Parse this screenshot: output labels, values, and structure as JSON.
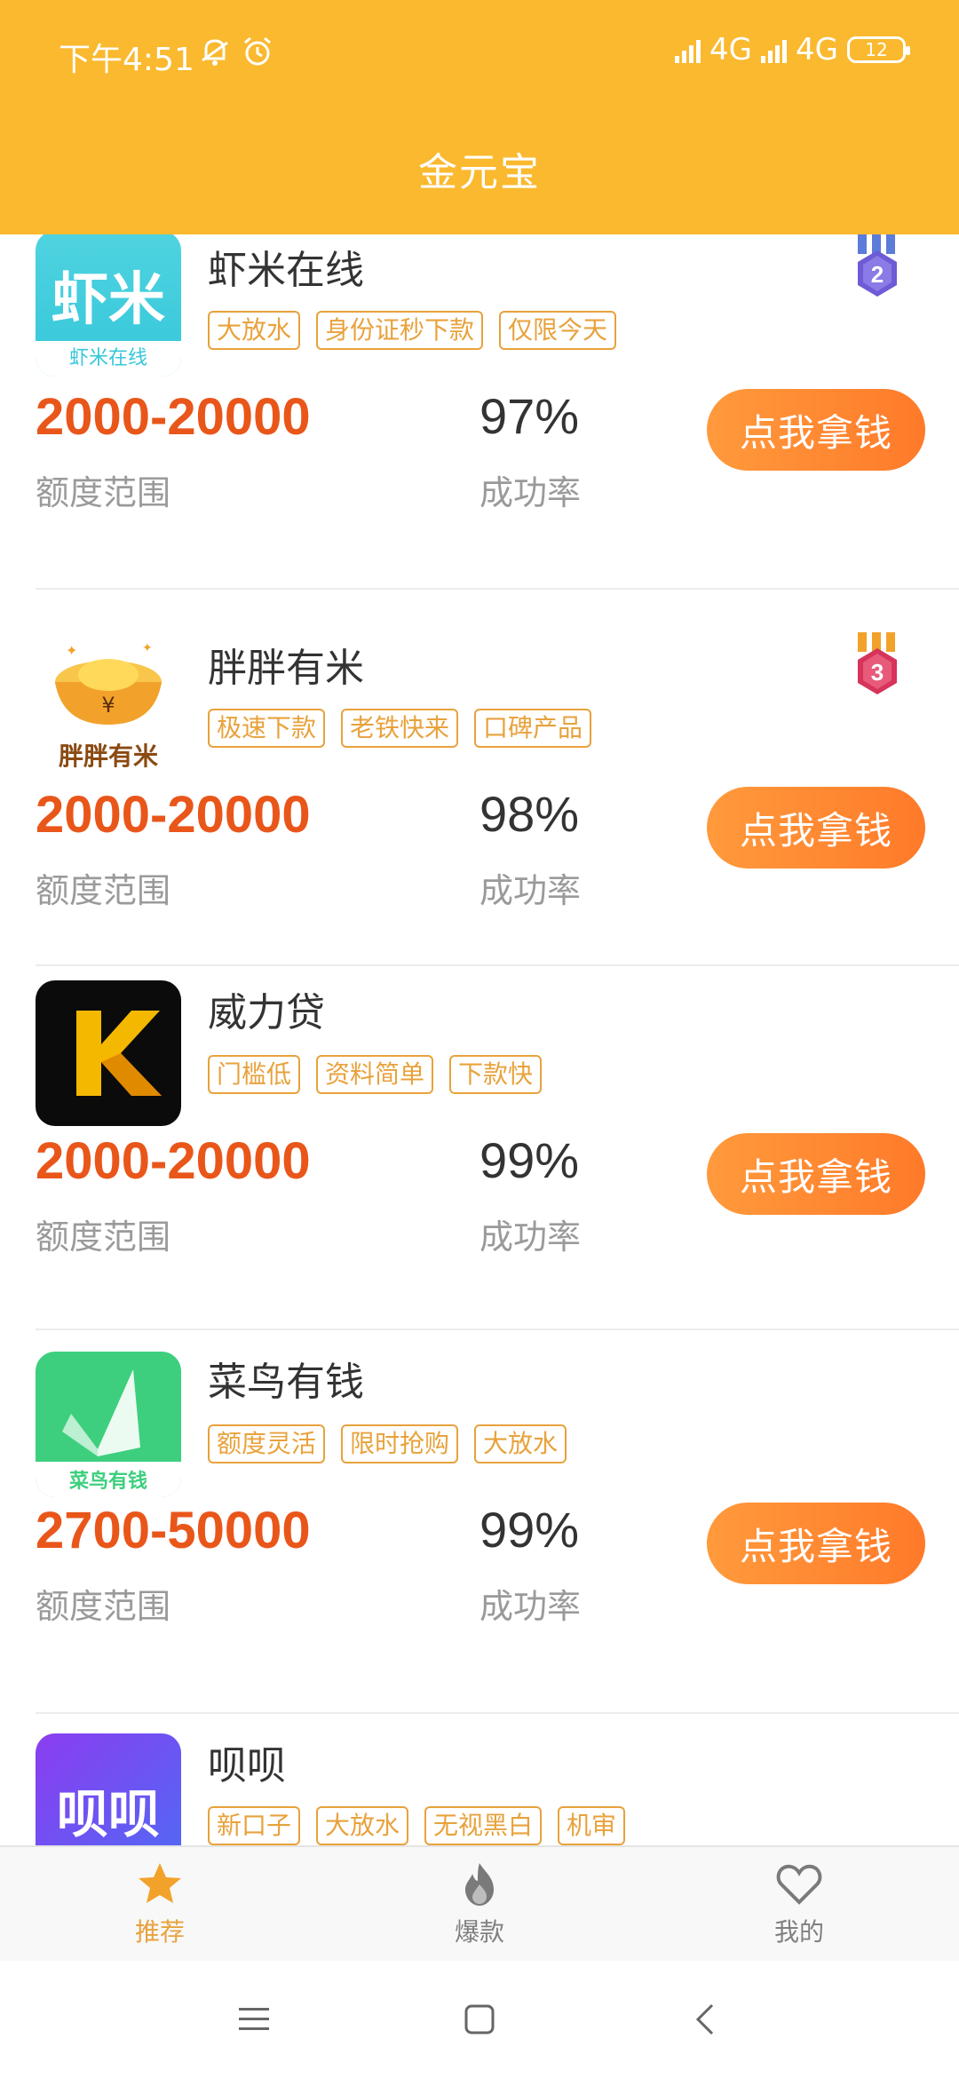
{
  "status_bar": {
    "time": "下午4:51",
    "network_1": "4G",
    "network_2": "4G",
    "battery": "12"
  },
  "header": {
    "title": "金元宝"
  },
  "products": [
    {
      "name": "虾米在线",
      "logo_text": "虾米",
      "logo_sub": "虾米在线",
      "tags": [
        "大放水",
        "身份证秒下款",
        "仅限今天"
      ],
      "range": "2000-20000",
      "range_label": "额度范围",
      "rate": "97%",
      "rate_label": "成功率",
      "cta": "点我拿钱",
      "rank": "2"
    },
    {
      "name": "胖胖有米",
      "logo_text": "胖胖有米",
      "tags": [
        "极速下款",
        "老铁快来",
        "口碑产品"
      ],
      "range": "2000-20000",
      "range_label": "额度范围",
      "rate": "98%",
      "rate_label": "成功率",
      "cta": "点我拿钱",
      "rank": "3"
    },
    {
      "name": "威力贷",
      "logo_text": "K",
      "tags": [
        "门槛低",
        "资料简单",
        "下款快"
      ],
      "range": "2000-20000",
      "range_label": "额度范围",
      "rate": "99%",
      "rate_label": "成功率",
      "cta": "点我拿钱"
    },
    {
      "name": "菜鸟有钱",
      "logo_text": "菜鸟有钱",
      "tags": [
        "额度灵活",
        "限时抢购",
        "大放水"
      ],
      "range": "2700-50000",
      "range_label": "额度范围",
      "rate": "99%",
      "rate_label": "成功率",
      "cta": "点我拿钱"
    },
    {
      "name": "呗呗",
      "logo_text": "呗呗",
      "tags": [
        "新口子",
        "大放水",
        "无视黑白",
        "机审"
      ]
    }
  ],
  "tabbar": {
    "tabs": [
      {
        "label": "推荐",
        "icon": "star-icon",
        "active": true
      },
      {
        "label": "爆款",
        "icon": "fire-icon",
        "active": false
      },
      {
        "label": "我的",
        "icon": "heart-icon",
        "active": false
      }
    ]
  },
  "colors": {
    "header_bg": "#FAB92F",
    "accent_orange": "#E9561A",
    "tag_color": "#E8A23C",
    "cta_gradient_start": "#FF9A3C",
    "cta_gradient_end": "#FF7A2A"
  }
}
